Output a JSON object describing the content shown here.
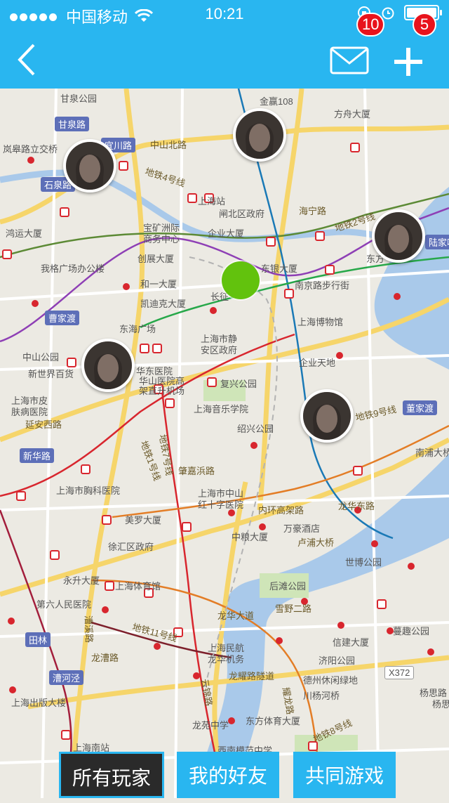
{
  "status": {
    "carrier": "中国移动",
    "time": "10:21"
  },
  "nav": {
    "mail_count": "10",
    "add_count": "5"
  },
  "map_labels": [
    "甘泉公园",
    "金赢108",
    "方舟大厦",
    "岚皋路立交桥",
    "中山北路",
    "上海站",
    "闸北区政府",
    "宝矿洲际",
    "商务中心",
    "企业大厦",
    "鸿运大厦",
    "创展大厦",
    "我格广场办公楼",
    "东银大厦",
    "和一大厦",
    "凯迪克大厦",
    "长征",
    "南京路步行街",
    "东海广场",
    "上海博物馆",
    "上海市静",
    "安区政府",
    "中山公园",
    "新世界百货",
    "华东医院",
    "华山医院高",
    "架直升机场",
    "复兴公园",
    "企业天地",
    "上海市皮",
    "肤病医院",
    "上海音乐学院",
    "绍兴公园",
    "延安西路",
    "肇嘉浜路",
    "南浦大桥",
    "上海市胸科医院",
    "上海市中山",
    "红十字医院",
    "内环高架路",
    "龙华东路",
    "美罗大厦",
    "万豪酒店",
    "徐汇区政府",
    "中粮大厦",
    "卢浦大桥",
    "永升大厦",
    "上海体育馆",
    "世博公园",
    "第六人民医院",
    "后滩公园",
    "雪野二路",
    "蔓趣公园",
    "龙华大道",
    "上海民航",
    "龙华机务",
    "信建大厦",
    "济阳公园",
    "龙耀路隧道",
    "德州休闲绿地",
    "川杨河桥",
    "上海出版大楼",
    "东方体育大厦",
    "龙苑中学",
    "上海南站",
    "西南模范中学",
    "杨思路",
    "地铁4号线",
    "地铁1号线",
    "地铁2号线",
    "地铁7号线",
    "地铁9号线",
    "地铁11号线",
    "地铁8号线",
    "漕溪路",
    "龙漕路",
    "云锦路",
    "耀龙路",
    "海宁路",
    "东方",
    "海宁路",
    "杨思"
  ],
  "box_labels": [
    "甘泉路",
    "宜川路",
    "石泉路",
    "曹家渡",
    "新华路",
    "董家渡",
    "陆家嘴",
    "田林",
    "漕河泾",
    "X372"
  ],
  "tabs": [
    {
      "label": "所有玩家"
    },
    {
      "label": "我的好友"
    },
    {
      "label": "共同游戏"
    }
  ],
  "colors": {
    "accent": "#29b6f0",
    "badge": "#e8131c",
    "dot": "#62c20d"
  }
}
